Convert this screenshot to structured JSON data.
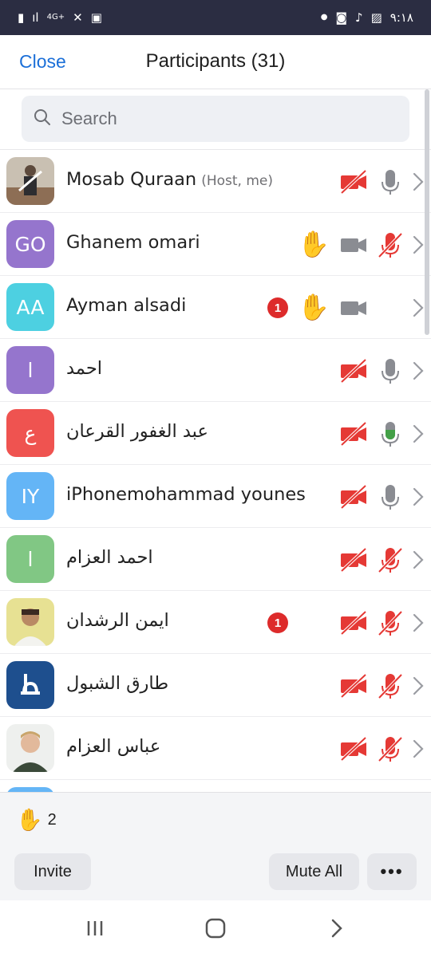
{
  "status_bar": {
    "time": "٩:١٨",
    "network": "4G+",
    "left_icons": [
      "battery-icon",
      "signal-icon",
      "network-icon",
      "mute-icon",
      "lock-icon"
    ],
    "right_icons": [
      "dot-icon",
      "app-icon",
      "bell-icon",
      "image-icon"
    ]
  },
  "header": {
    "close_label": "Close",
    "title": "Participants (31)"
  },
  "search": {
    "placeholder": "Search"
  },
  "participants": [
    {
      "name": "Mosab Quraan",
      "host_tag": "(Host, me)",
      "avatar": "photo",
      "video": "off",
      "mic": "idle"
    },
    {
      "name": "Ghanem omari",
      "avatar_text": "GO",
      "avatar_color": "#9575cd",
      "hand": true,
      "video": "on",
      "mic": "muted"
    },
    {
      "name": "Ayman alsadi",
      "avatar_text": "AA",
      "avatar_color": "#4dd0e1",
      "badge": "1",
      "hand": true,
      "video": "on",
      "mic": "none"
    },
    {
      "name": "احمد",
      "avatar_text": "ا",
      "avatar_color": "#9575cd",
      "video": "off",
      "mic": "idle"
    },
    {
      "name": "عبد الغفور القرعان",
      "avatar_text": "ع",
      "avatar_color": "#ef5350",
      "video": "off",
      "mic": "speaking"
    },
    {
      "name": "iPhonemohammad younes",
      "avatar_text": "IY",
      "avatar_color": "#64b5f6",
      "video": "off",
      "mic": "idle"
    },
    {
      "name": "احمد العزام",
      "avatar_text": "ا",
      "avatar_color": "#81c784",
      "video": "off",
      "mic": "muted"
    },
    {
      "name": "ايمن الرشدان",
      "avatar": "photo",
      "badge": "1",
      "video": "off",
      "mic": "muted"
    },
    {
      "name": "طارق الشبول",
      "avatar": "logo",
      "video": "off",
      "mic": "muted"
    },
    {
      "name": "عباس العزام",
      "avatar": "photo",
      "video": "off",
      "mic": "muted"
    }
  ],
  "footer": {
    "raised_hands": "2",
    "invite_label": "Invite",
    "mute_all_label": "Mute All",
    "more_label": "•••"
  },
  "colors": {
    "accent": "#1b6fd8",
    "muted_red": "#e53935",
    "speaking_green": "#43a047",
    "icon_gray": "#8a8c92",
    "hand_yellow": "#f6c12d"
  }
}
